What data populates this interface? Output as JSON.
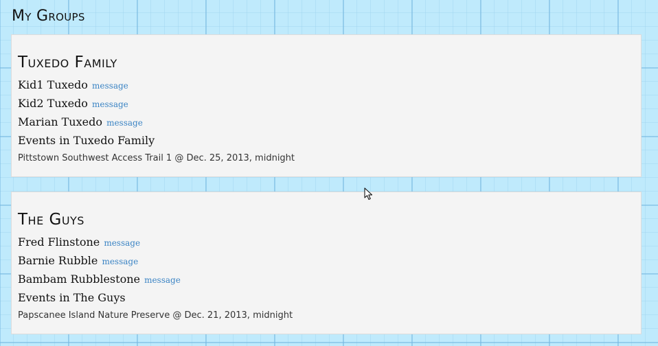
{
  "page": {
    "title": "My Groups"
  },
  "groups": [
    {
      "name": "Tuxedo Family",
      "members": [
        {
          "name": "Kid1 Tuxedo",
          "action": "message"
        },
        {
          "name": "Kid2 Tuxedo",
          "action": "message"
        },
        {
          "name": "Marian Tuxedo",
          "action": "message"
        }
      ],
      "events_heading": "Events in Tuxedo Family",
      "events": [
        "Pittstown Southwest Access Trail 1 @ Dec. 25, 2013, midnight"
      ]
    },
    {
      "name": "The Guys",
      "members": [
        {
          "name": "Fred Flinstone",
          "action": "message"
        },
        {
          "name": "Barnie Rubble",
          "action": "message"
        },
        {
          "name": "Bambam Rubblestone",
          "action": "message"
        }
      ],
      "events_heading": "Events in The Guys",
      "events": [
        "Papscanee Island Nature Preserve @ Dec. 21, 2013, midnight"
      ]
    }
  ],
  "colors": {
    "background": "#bfeafc",
    "card": "#f4f4f4",
    "link": "#3b84c4"
  },
  "cursor_icon": "mouse-pointer-icon"
}
